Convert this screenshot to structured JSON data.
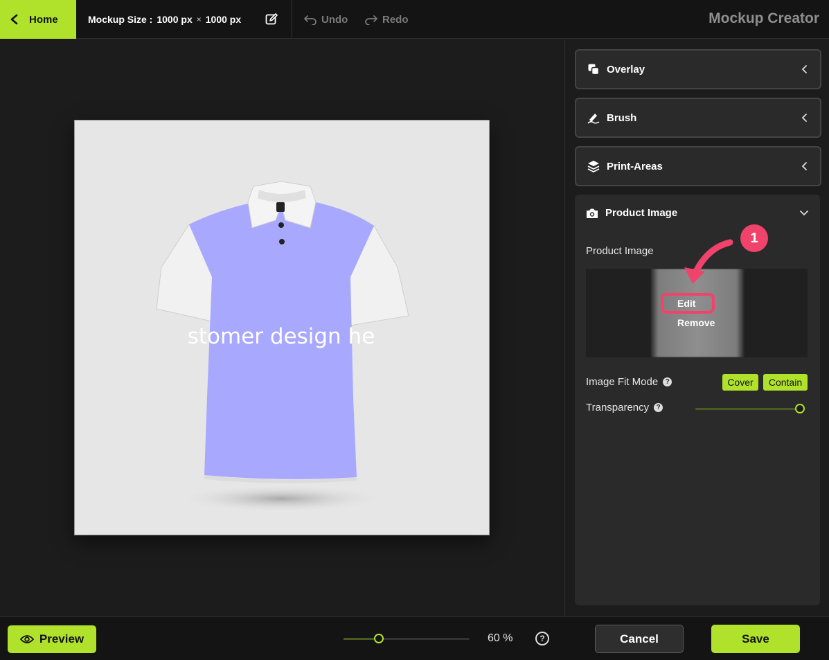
{
  "topbar": {
    "home_label": "Home",
    "size_label": "Mockup Size :",
    "width_value": "1000 px",
    "times": "×",
    "height_value": "1000 px",
    "undo_label": "Undo",
    "redo_label": "Redo",
    "app_title": "Mockup Creator"
  },
  "canvas": {
    "shirt_text": "stomer design he",
    "shirt_color": "#a8a8ff"
  },
  "panel": {
    "sections": [
      {
        "label": "Overlay",
        "icon": "overlay-icon"
      },
      {
        "label": "Brush",
        "icon": "brush-icon"
      },
      {
        "label": "Print-Areas",
        "icon": "layers-icon"
      }
    ],
    "product_image": {
      "title": "Product Image",
      "field_label": "Product Image",
      "edit_label": "Edit",
      "remove_label": "Remove",
      "fit_mode_label": "Image Fit Mode",
      "fit_options": [
        "Cover",
        "Contain"
      ],
      "transparency_label": "Transparency",
      "transparency_value": 1.0
    }
  },
  "annotation": {
    "step": "1"
  },
  "bottombar": {
    "preview_label": "Preview",
    "zoom_value": "60 %",
    "zoom_fraction": 0.28,
    "cancel_label": "Cancel",
    "save_label": "Save"
  },
  "colors": {
    "accent": "#b1e22b",
    "highlight": "#f0436c"
  }
}
